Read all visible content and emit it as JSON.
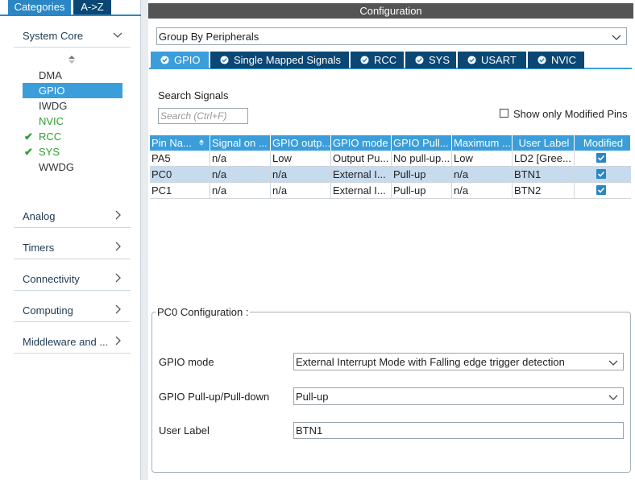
{
  "left": {
    "tabs": {
      "categories": "Categories",
      "az": "A->Z"
    },
    "system_core": {
      "label": "System Core",
      "items": [
        {
          "label": "DMA",
          "checked": false,
          "selected": false,
          "color": "#333333"
        },
        {
          "label": "GPIO",
          "checked": false,
          "selected": true,
          "color": "#ffffff"
        },
        {
          "label": "IWDG",
          "checked": false,
          "selected": false,
          "color": "#333333"
        },
        {
          "label": "NVIC",
          "checked": false,
          "selected": false,
          "color": "#2e9f33"
        },
        {
          "label": "RCC",
          "checked": true,
          "selected": false,
          "color": "#2e9f33"
        },
        {
          "label": "SYS",
          "checked": true,
          "selected": false,
          "color": "#2e9f33"
        },
        {
          "label": "WWDG",
          "checked": false,
          "selected": false,
          "color": "#333333"
        }
      ]
    },
    "categories": [
      "Analog",
      "Timers",
      "Connectivity",
      "Computing",
      "Middleware and ..."
    ]
  },
  "right": {
    "title": "Configuration",
    "group_by": "Group By Peripherals",
    "tabs": [
      "GPIO",
      "Single Mapped Signals",
      "RCC",
      "SYS",
      "USART",
      "NVIC"
    ],
    "active_tab": "GPIO",
    "search": {
      "label": "Search Signals",
      "placeholder": "Search (Ctrl+F)"
    },
    "only_modified": "Show only Modified Pins",
    "table": {
      "columns": [
        "Pin Na...",
        "Signal on ...",
        "GPIO outp...",
        "GPIO mode",
        "GPIO Pull...",
        "Maximum ...",
        "User Label",
        "Modified"
      ],
      "rows": [
        [
          "PA5",
          "n/a",
          "Low",
          "Output Pu...",
          "No pull-up...",
          "Low",
          "LD2 [Gree...",
          true
        ],
        [
          "PC0",
          "n/a",
          "n/a",
          "External I...",
          "Pull-up",
          "n/a",
          "BTN1",
          true
        ],
        [
          "PC1",
          "n/a",
          "n/a",
          "External I...",
          "Pull-up",
          "n/a",
          "BTN2",
          true
        ]
      ],
      "selected_row": 1
    },
    "config": {
      "title": "PC0 Configuration :",
      "gpio_mode_label": "GPIO mode",
      "gpio_mode_value": "External Interrupt Mode with Falling edge trigger detection",
      "pull_label": "GPIO Pull-up/Pull-down",
      "pull_value": "Pull-up",
      "user_label_label": "User Label",
      "user_label_value": "BTN1"
    }
  },
  "colors": {
    "accent": "#3b9edb",
    "dark_tab": "#0b4774",
    "header_bar": "#545454",
    "check_green": "#2e9f33"
  }
}
